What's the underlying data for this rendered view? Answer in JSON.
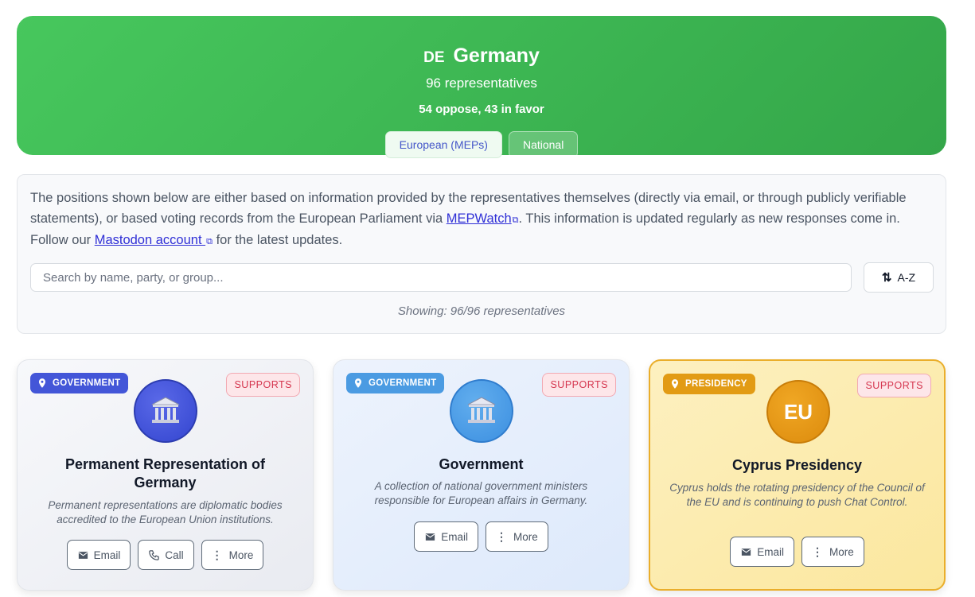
{
  "header": {
    "country_code": "DE",
    "country_name": "Germany",
    "rep_count": "96 representatives",
    "stance_summary": "54 oppose, 43 in favor",
    "tabs": [
      {
        "label": "European (MEPs)",
        "active": true
      },
      {
        "label": "National",
        "active": false
      }
    ],
    "accent_color": "#3cb552"
  },
  "info": {
    "text_before_link1": "The positions shown below are either based on information provided by the representatives themselves (directly via email, or through publicly verifiable statements), or based voting records from the European Parliament via ",
    "link1": "MEPWatch",
    "text_between_links": ". This information is updated regularly as new responses come in. Follow our ",
    "link2": "Mastodon account ",
    "text_after_link2": " for the latest updates.",
    "search_placeholder": "Search by name, party, or group...",
    "sort_label": "A-Z",
    "showing": "Showing: 96/96 representatives"
  },
  "cards": [
    {
      "tag": "GOVERNMENT",
      "stance": "SUPPORTS",
      "avatar": "bank-building-icon",
      "name": "Permanent Representation of Germany",
      "description": "Permanent representations are diplomatic bodies accredited to the European Union institutions.",
      "actions": [
        "Email",
        "Call",
        "More"
      ]
    },
    {
      "tag": "GOVERNMENT",
      "stance": "SUPPORTS",
      "avatar": "bank-building-icon",
      "name": "Government",
      "description": "A collection of national government ministers responsible for European affairs in Germany.",
      "actions": [
        "Email",
        "More"
      ]
    },
    {
      "tag": "PRESIDENCY",
      "stance": "SUPPORTS",
      "avatar_text": "EU",
      "name": "Cyprus Presidency",
      "description": "Cyprus holds the rotating presidency of the Council of the EU and is continuing to push Chat Control.",
      "actions": [
        "Email",
        "More"
      ]
    }
  ]
}
